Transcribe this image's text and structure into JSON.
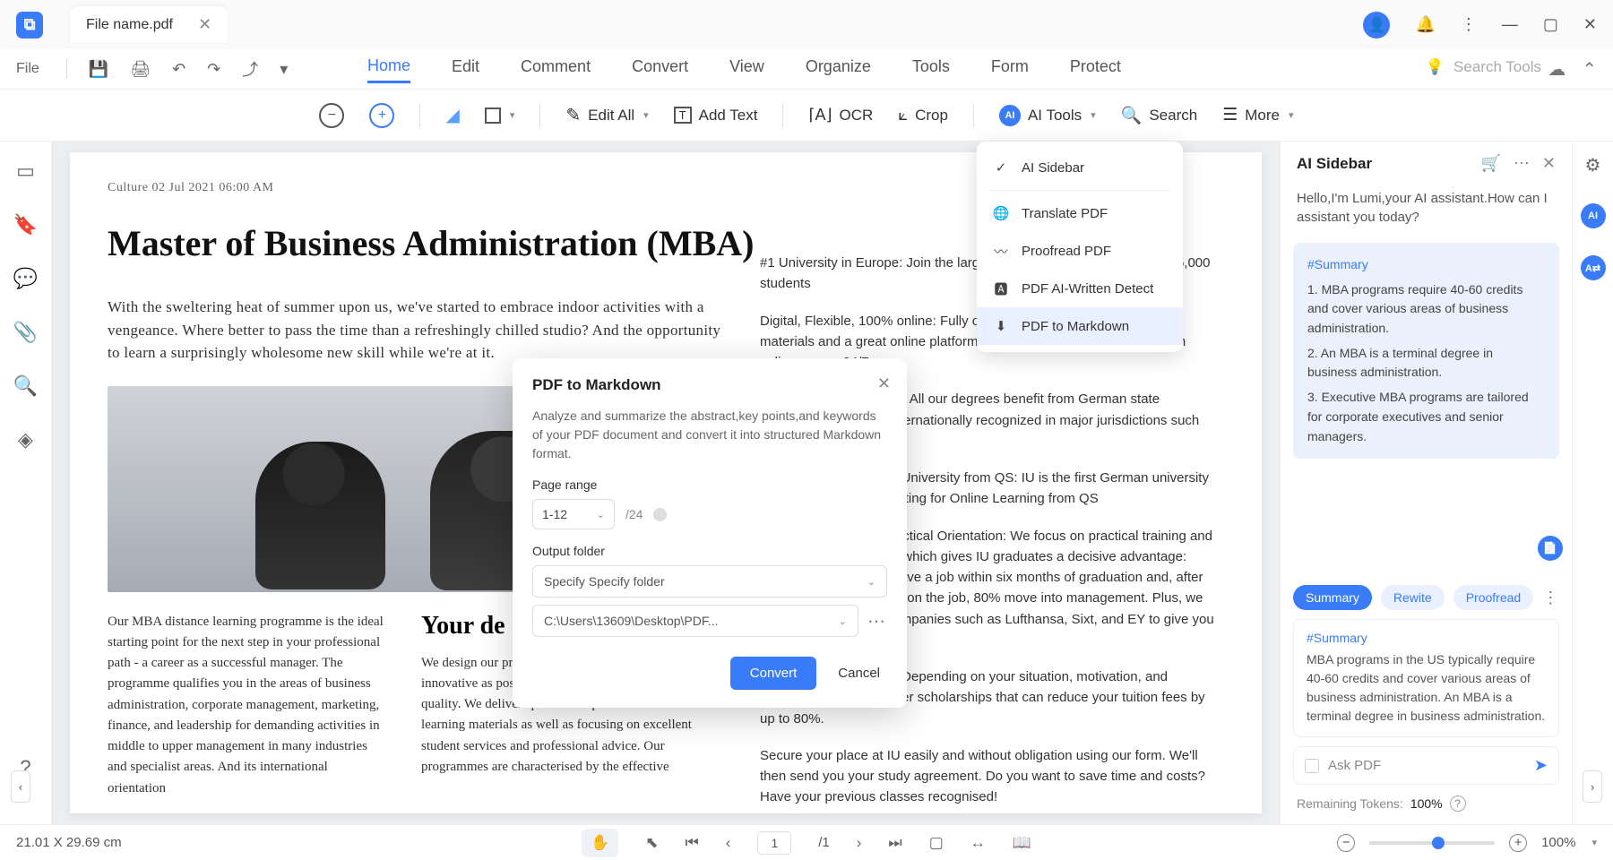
{
  "title_bar": {
    "file_name": "File name.pdf"
  },
  "quick_bar": {
    "file_label": "File"
  },
  "menu": {
    "items": [
      "Home",
      "Edit",
      "Comment",
      "Convert",
      "View",
      "Organize",
      "Tools",
      "Form",
      "Protect"
    ],
    "active": 0,
    "search_placeholder": "Search Tools"
  },
  "ribbon": {
    "edit_all": "Edit All",
    "add_text": "Add Text",
    "ocr": "OCR",
    "crop": "Crop",
    "ai_tools": "AI Tools",
    "search": "Search",
    "more": "More"
  },
  "ai_menu": {
    "sidebar": "AI Sidebar",
    "translate": "Translate PDF",
    "proofread": "Proofread PDF",
    "detect": "PDF AI-Written Detect",
    "markdown": "PDF to Markdown"
  },
  "modal": {
    "title": "PDF to Markdown",
    "desc": "Analyze and summarize the abstract,key points,and keywords of your PDF document and convert it into structured Markdown format.",
    "page_range_label": "Page range",
    "page_range_value": "1-12",
    "page_total": "/24",
    "output_label": "Output folder",
    "output_mode": "Specify Specify folder",
    "output_path": "C:\\Users\\13609\\Desktop\\PDF...",
    "convert": "Convert",
    "cancel": "Cancel"
  },
  "ai_sidebar": {
    "title": "AI Sidebar",
    "greeting": "Hello,I'm Lumi,your AI assistant.How can I assistant you today?",
    "summary_title": "Summary",
    "summary_items": [
      "1. MBA programs require 40-60 credits and cover various areas of business administration.",
      "2. An MBA is a terminal degree in business administration.",
      "3. Executive MBA programs are tailored for corporate executives and senior managers."
    ],
    "pills": [
      "Summary",
      "Rewite",
      "Proofread"
    ],
    "result_title": "Summary",
    "result_body": "MBA programs in the US typically require 40-60 credits and cover various areas of business administration. An MBA is a terminal degree in business administration.",
    "ask_placeholder": "Ask PDF",
    "tokens_label": "Remaining Tokens:",
    "tokens_value": "100%"
  },
  "document": {
    "meta": "Culture 02 Jul 2021 06:00 AM",
    "title": "Master of Business Administration (MBA)",
    "intro": "With the sweltering heat of summer upon us, we've started to embrace indoor activities with a vengeance. Where better to pass the time than a refreshingly chilled studio? And the opportunity to learn a surprisingly wholesome new skill while we're at it.",
    "left_col": "Our MBA distance learning programme is the ideal starting point for the next step in your professional path - a career as a successful manager. The programme qualifies you in the areas of business administration, corporate management, marketing, finance, and leadership for demanding activities in middle to upper management in many industries and specialist areas. And its international orientation",
    "h2": "Your de",
    "right_col_1": "We design our programmes to be as flexible and innovative as possible, without compromising on quality. We deliver specialist expertise and innovative learning materials as well as focusing on excellent student services and professional advice. Our programmes are characterised by the effective",
    "side": [
      "#1 University in Europe: Join the largest in Germany, with more than 85,000 students",
      "Digital, Flexible, 100% online: Fully online studies with digital learning materials and a great online platform. Study from wherever you are with online exams 24/7.",
      "Fully Accredited Degree: All our degrees benefit from German state accreditation and are internationally recognized in major jurisdictions such as the EU, US and",
      "Learn from 5-star rated University from QS: IU is the first German university that achieved a 5-star rating for Online Learning from QS",
      "International Focus, Practical Orientation: We focus on practical training and an international outlook which gives IU graduates a decisive advantage: 94% of our graduates have a job within six months of graduation and, after an average of two years on the job, 80% move into management. Plus, we work closely with big companies such as Lufthansa, Sixt, and EY to give you great opportunities and",
      "Scholarships Available: Depending on your situation, motivation, and background, we also offer scholarships that can reduce your tuition fees by up to 80%.",
      "Secure your place at IU easily and without obligation using our form. We'll then send you your study agreement. Do you want to save time and costs? Have your previous classes recognised!"
    ]
  },
  "status": {
    "dimensions": "21.01 X 29.69 cm",
    "page_current": "1",
    "page_total": "/1",
    "zoom": "100%"
  }
}
